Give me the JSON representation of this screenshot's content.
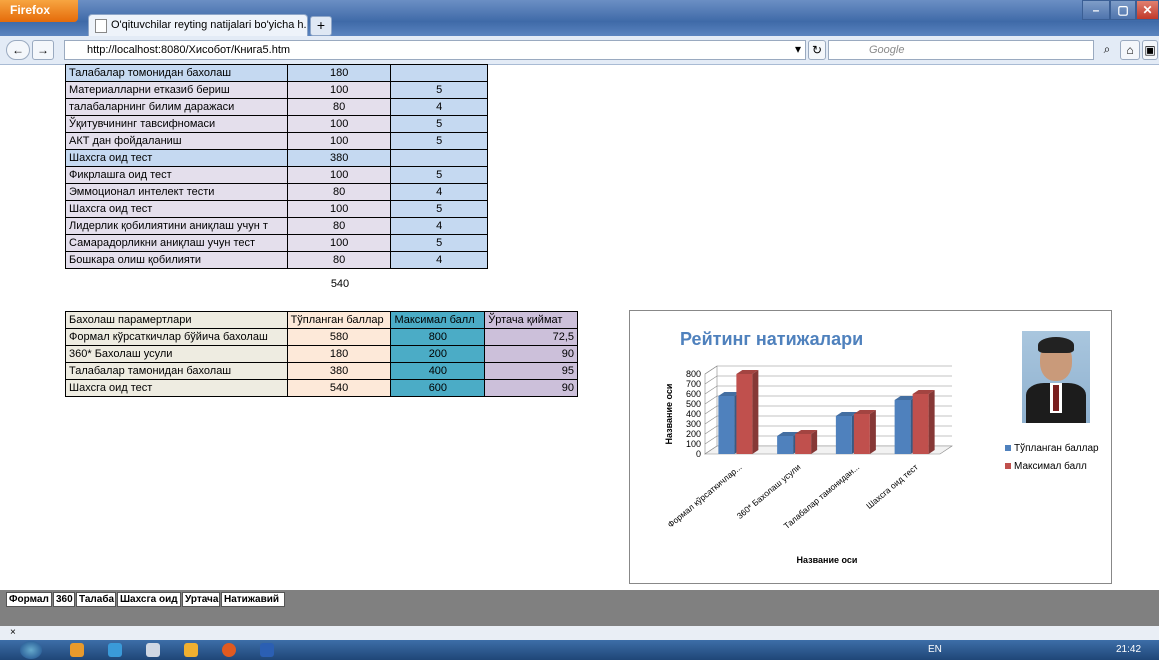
{
  "browser": {
    "menu_label": "Firefox",
    "tab_title": "O'qituvchilar reyting natijalari bo'yicha h...",
    "new_tab": "+",
    "url": "http://localhost:8080/Хисобот/Книга5.htm",
    "search_placeholder": "Google"
  },
  "top_table": {
    "rows": [
      {
        "label": "Талабалар томонидан бахолаш",
        "a": "180",
        "b": "",
        "style": "blue"
      },
      {
        "label": "Материалларни етказиб бериш",
        "a": "100",
        "b": "5",
        "style": "plain"
      },
      {
        "label": " талабаларнинг билим даражаси",
        "a": "80",
        "b": "4",
        "style": "plain"
      },
      {
        "label": "Ўқитувчининг тавсифномаси",
        "a": "100",
        "b": "5",
        "style": "plain"
      },
      {
        "label": "АКТ дан фойдаланиш",
        "a": "100",
        "b": "5",
        "style": "plain"
      },
      {
        "label": "Шахсга оид тест",
        "a": "380",
        "b": "",
        "style": "blue"
      },
      {
        "label": "Фикрлашга оид  тест",
        "a": "100",
        "b": "5",
        "style": "plain"
      },
      {
        "label": "Эммоционал интелект тести",
        "a": "80",
        "b": "4",
        "style": "plain"
      },
      {
        "label": "Шахсга оид тест",
        "a": "100",
        "b": "5",
        "style": "plain"
      },
      {
        "label": "Лидерлик қобилиятини аниқлаш учун т",
        "a": "80",
        "b": "4",
        "style": "plain"
      },
      {
        "label": "Самарадорликни аниқлаш учун тест",
        "a": "100",
        "b": "5",
        "style": "plain"
      },
      {
        "label": "Бошкара олиш қобилияти",
        "a": "80",
        "b": "4",
        "style": "plain"
      }
    ],
    "total": "540"
  },
  "summary_table": {
    "headers": [
      "Бахолаш парамертлари",
      "Тўпланган баллар",
      "Максимал балл",
      "Ўртача қиймат"
    ],
    "rows": [
      [
        "Формал кўрсаткичлар бўйича бахолаш",
        "580",
        "800",
        "72,5"
      ],
      [
        "360* Бахолаш усули",
        "180",
        "200",
        "90"
      ],
      [
        "Талабалар тамонидан бахолаш",
        "380",
        "400",
        "95"
      ],
      [
        "Шахсга оид тест",
        "540",
        "600",
        "90"
      ]
    ]
  },
  "chart_data": {
    "type": "bar",
    "title": "Рейтинг натижалари",
    "xlabel": "Название оси",
    "ylabel": "Название оси",
    "categories": [
      "Формал кўрсаткичлар...",
      "360* Бахолаш усули",
      "Талабалар тамонидан...",
      "Шахсга оид тест"
    ],
    "ylim": [
      0,
      800
    ],
    "yticks": [
      "0",
      "100",
      "200",
      "300",
      "400",
      "500",
      "600",
      "700",
      "800"
    ],
    "series": [
      {
        "name": "Тўпланган баллар",
        "values": [
          580,
          180,
          380,
          540
        ],
        "color": "#4f81bd"
      },
      {
        "name": "Максимал балл",
        "values": [
          800,
          200,
          400,
          600
        ],
        "color": "#c0504d"
      }
    ],
    "legend": "right",
    "grid": true
  },
  "sheet_tabs": [
    "Формал",
    "360",
    "Талаба",
    "Шахсга оид",
    "Уртача",
    "Натижавий"
  ],
  "taskbar": {
    "lang": "EN",
    "time": "21:42"
  },
  "colors": {
    "blue_row": "#c5d9f1",
    "lavender": "#e4dfec",
    "peach": "#fde9d9",
    "teal": "#4bacc6",
    "purple": "#ccc0da",
    "tan": "#eeece1"
  }
}
